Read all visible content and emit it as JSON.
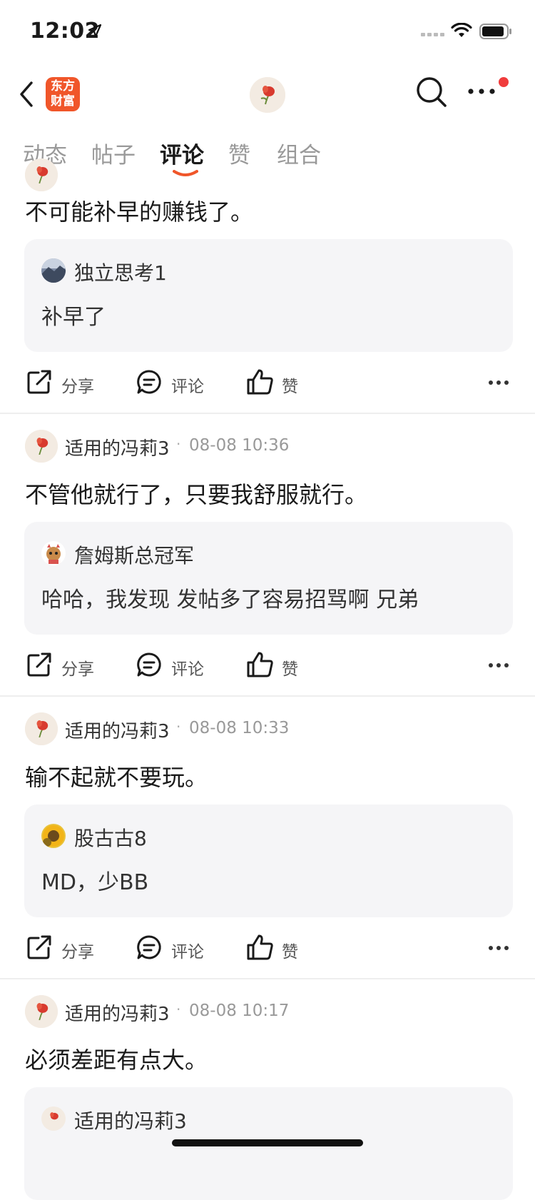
{
  "status_bar": {
    "time": "12:02"
  },
  "brand": {
    "line1": "东方",
    "line2": "财富"
  },
  "tabs": [
    "动态",
    "帖子",
    "评论",
    "赞",
    "组合"
  ],
  "active_tab": "评论",
  "actions": {
    "share": "分享",
    "comment": "评论",
    "like": "赞"
  },
  "comments": [
    {
      "text": "不可能补早的赚钱了。",
      "quote": {
        "author": "独立思考1",
        "text": "补早了",
        "avatar_icon": "mountain-avatar-icon"
      }
    },
    {
      "author": "适用的冯莉3",
      "time": "08-08 10:36",
      "text": "不管他就行了，只要我舒服就行。",
      "quote": {
        "author": "詹姆斯总冠军",
        "text": "哈哈，我发现 发帖多了容易招骂啊 兄弟",
        "avatar_icon": "mascot-avatar-icon"
      }
    },
    {
      "author": "适用的冯莉3",
      "time": "08-08 10:33",
      "text": "输不起就不要玩。",
      "quote": {
        "author": "股古古8",
        "text": "MD，少BB",
        "avatar_icon": "sunflower-avatar-icon"
      }
    },
    {
      "author": "适用的冯莉3",
      "time": "08-08 10:17",
      "text": "必须差距有点大。",
      "quote": {
        "author": "适用的冯莉3",
        "text": "",
        "avatar_icon": "flower-avatar-icon"
      }
    }
  ],
  "colors": {
    "brand": "#f0562a",
    "accent_underline": "#f0562a",
    "notification_dot": "#f03c3c",
    "quote_bg": "#f5f5f7"
  }
}
